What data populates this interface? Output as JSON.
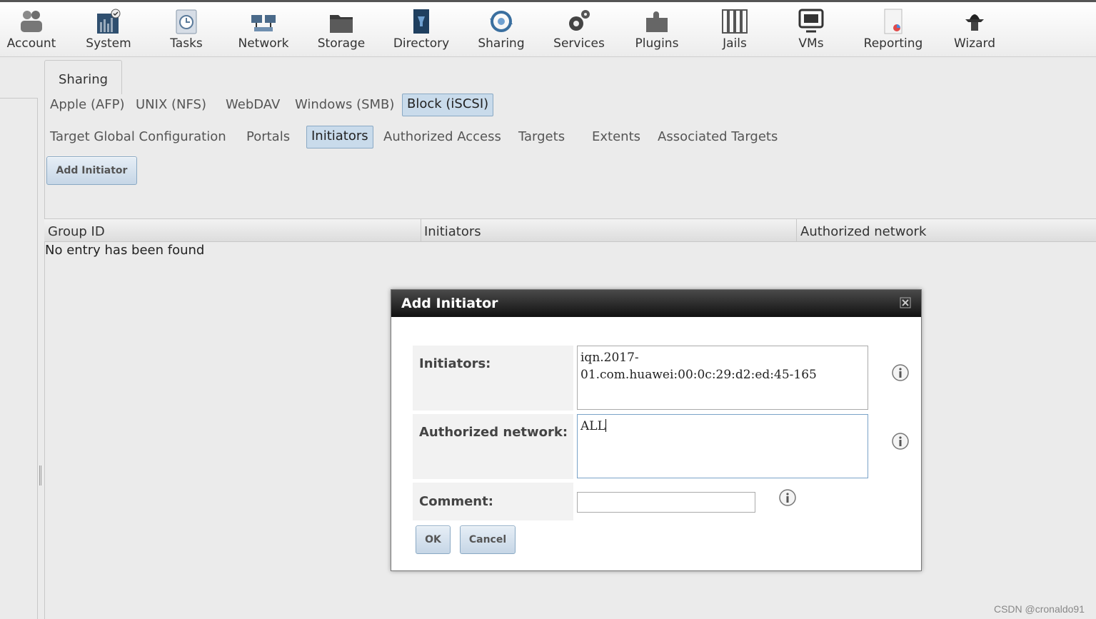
{
  "nav": {
    "items": [
      {
        "label": "Account",
        "icon": "account-icon"
      },
      {
        "label": "System",
        "icon": "system-icon"
      },
      {
        "label": "Tasks",
        "icon": "tasks-icon"
      },
      {
        "label": "Network",
        "icon": "network-icon"
      },
      {
        "label": "Storage",
        "icon": "storage-icon"
      },
      {
        "label": "Directory",
        "icon": "directory-icon"
      },
      {
        "label": "Sharing",
        "icon": "sharing-icon"
      },
      {
        "label": "Services",
        "icon": "services-icon"
      },
      {
        "label": "Plugins",
        "icon": "plugins-icon"
      },
      {
        "label": "Jails",
        "icon": "jails-icon"
      },
      {
        "label": "VMs",
        "icon": "vms-icon"
      },
      {
        "label": "Reporting",
        "icon": "reporting-icon"
      },
      {
        "label": "Wizard",
        "icon": "wizard-icon"
      }
    ]
  },
  "main_tab": {
    "label": "Sharing"
  },
  "share_tabs": [
    {
      "label": "Apple (AFP)",
      "active": false
    },
    {
      "label": "UNIX (NFS)",
      "active": false
    },
    {
      "label": "WebDAV",
      "active": false
    },
    {
      "label": "Windows (SMB)",
      "active": false
    },
    {
      "label": "Block (iSCSI)",
      "active": true
    }
  ],
  "iscsi_tabs": [
    {
      "label": "Target Global Configuration",
      "active": false
    },
    {
      "label": "Portals",
      "active": false
    },
    {
      "label": "Initiators",
      "active": true
    },
    {
      "label": "Authorized Access",
      "active": false
    },
    {
      "label": "Targets",
      "active": false
    },
    {
      "label": "Extents",
      "active": false
    },
    {
      "label": "Associated Targets",
      "active": false
    }
  ],
  "add_button": {
    "label": "Add Initiator"
  },
  "table": {
    "columns": [
      "Group ID",
      "Initiators",
      "Authorized network"
    ],
    "empty_message": "No entry has been found"
  },
  "dialog": {
    "title": "Add Initiator",
    "fields": {
      "initiators": {
        "label": "Initiators:",
        "value": "iqn.2017-\n01.com.huawei:00:0c:29:d2:ed:45-165"
      },
      "network": {
        "label": "Authorized network:",
        "value": "ALL"
      },
      "comment": {
        "label": "Comment:",
        "value": ""
      }
    },
    "ok_label": "OK",
    "cancel_label": "Cancel"
  },
  "watermark": "CSDN @cronaldo91",
  "colors": {
    "active_tab": "#c9dbeb",
    "title_bar": "#1a1a1a",
    "accent_border": "#8aa9c4"
  }
}
